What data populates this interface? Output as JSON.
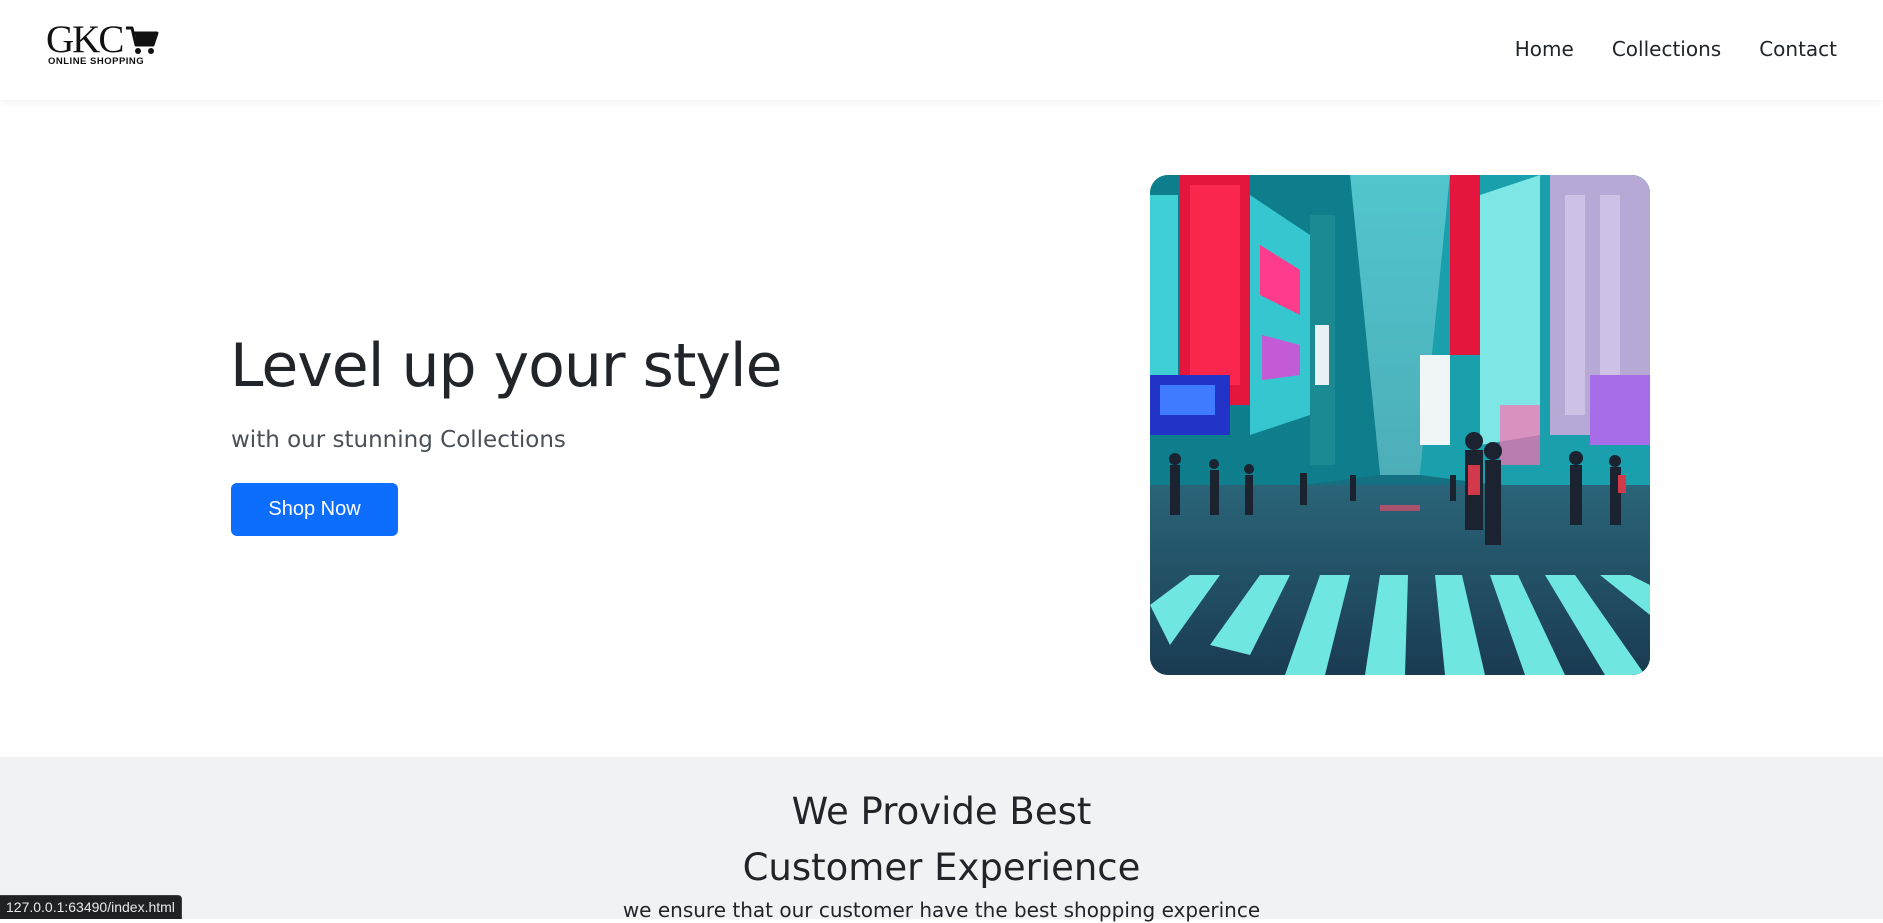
{
  "brand": {
    "logo_text": "GKC",
    "logo_subtext": "ONLINE SHOPPING"
  },
  "nav": {
    "items": [
      {
        "label": "Home"
      },
      {
        "label": "Collections"
      },
      {
        "label": "Contact"
      }
    ]
  },
  "hero": {
    "title": "Level up your style",
    "subtitle": "with our stunning Collections",
    "cta_label": "Shop Now",
    "image_icon": "city-street-photo"
  },
  "features": {
    "title_line1": "We Provide Best",
    "title_line2": "Customer Experience",
    "text": "we ensure that our customer have the best shopping experince"
  },
  "status_bar": {
    "url": "127.0.0.1:63490/index.html"
  },
  "colors": {
    "primary_button": "#0d6efd",
    "text_dark": "#212529",
    "section_bg": "#f1f2f4"
  }
}
